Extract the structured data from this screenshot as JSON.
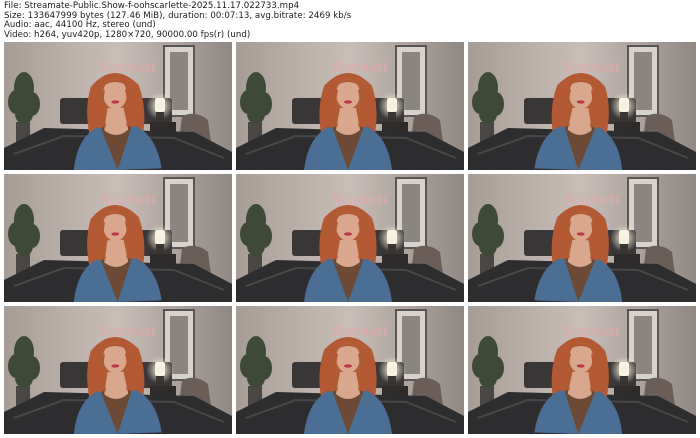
{
  "header": {
    "file_line": "File: Streamate-Public.Show-f-oohscarlette-2025.11.17.022733.mp4",
    "size_line": "Size: 133647999 bytes (127.46 MiB), duration: 00:07:13, avg.bitrate: 2469 kb/s",
    "audio_line": "Audio: aac, 44100 Hz, stereo (und)",
    "video_line": "Video: h264, yuv420p, 1280×720, 90000.00 fps(r) (und)"
  },
  "grid": {
    "columns": 3,
    "rows": 3,
    "thumb_count": 9
  },
  "scene": {
    "wall_sign_text": "Scarlett",
    "colors": {
      "wall": "#c9bdb7",
      "sign": "#e8a7b0",
      "jacket": "#4b6e95",
      "hair": "#b35a34",
      "skin": "#d9a78e",
      "top": "#6c4a35",
      "bed": "#2d2c2e",
      "lamp": "#f4ecd6"
    }
  }
}
